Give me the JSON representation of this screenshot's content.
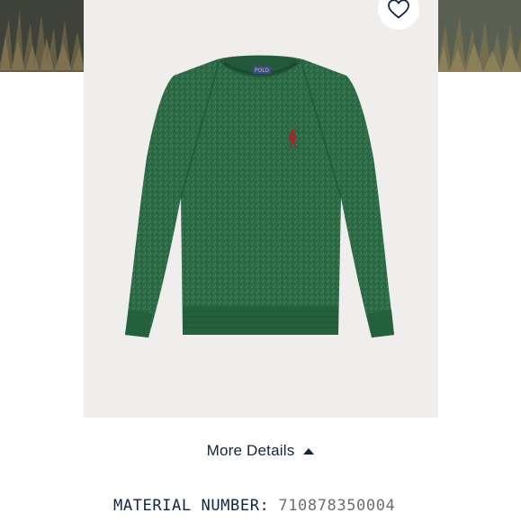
{
  "product": {
    "image_alt": "Green crewneck sweater",
    "logo_text": "POLO",
    "favorite_icon": "heart-outline-icon",
    "colors": {
      "sweater": "#2b6a44",
      "background": "#efeeec",
      "pony": "#9b2c2c"
    }
  },
  "details": {
    "toggle_label": "More Details",
    "toggle_icon": "caret-up-icon",
    "material_label": "MATERIAL NUMBER:",
    "material_value": "710878350004"
  }
}
